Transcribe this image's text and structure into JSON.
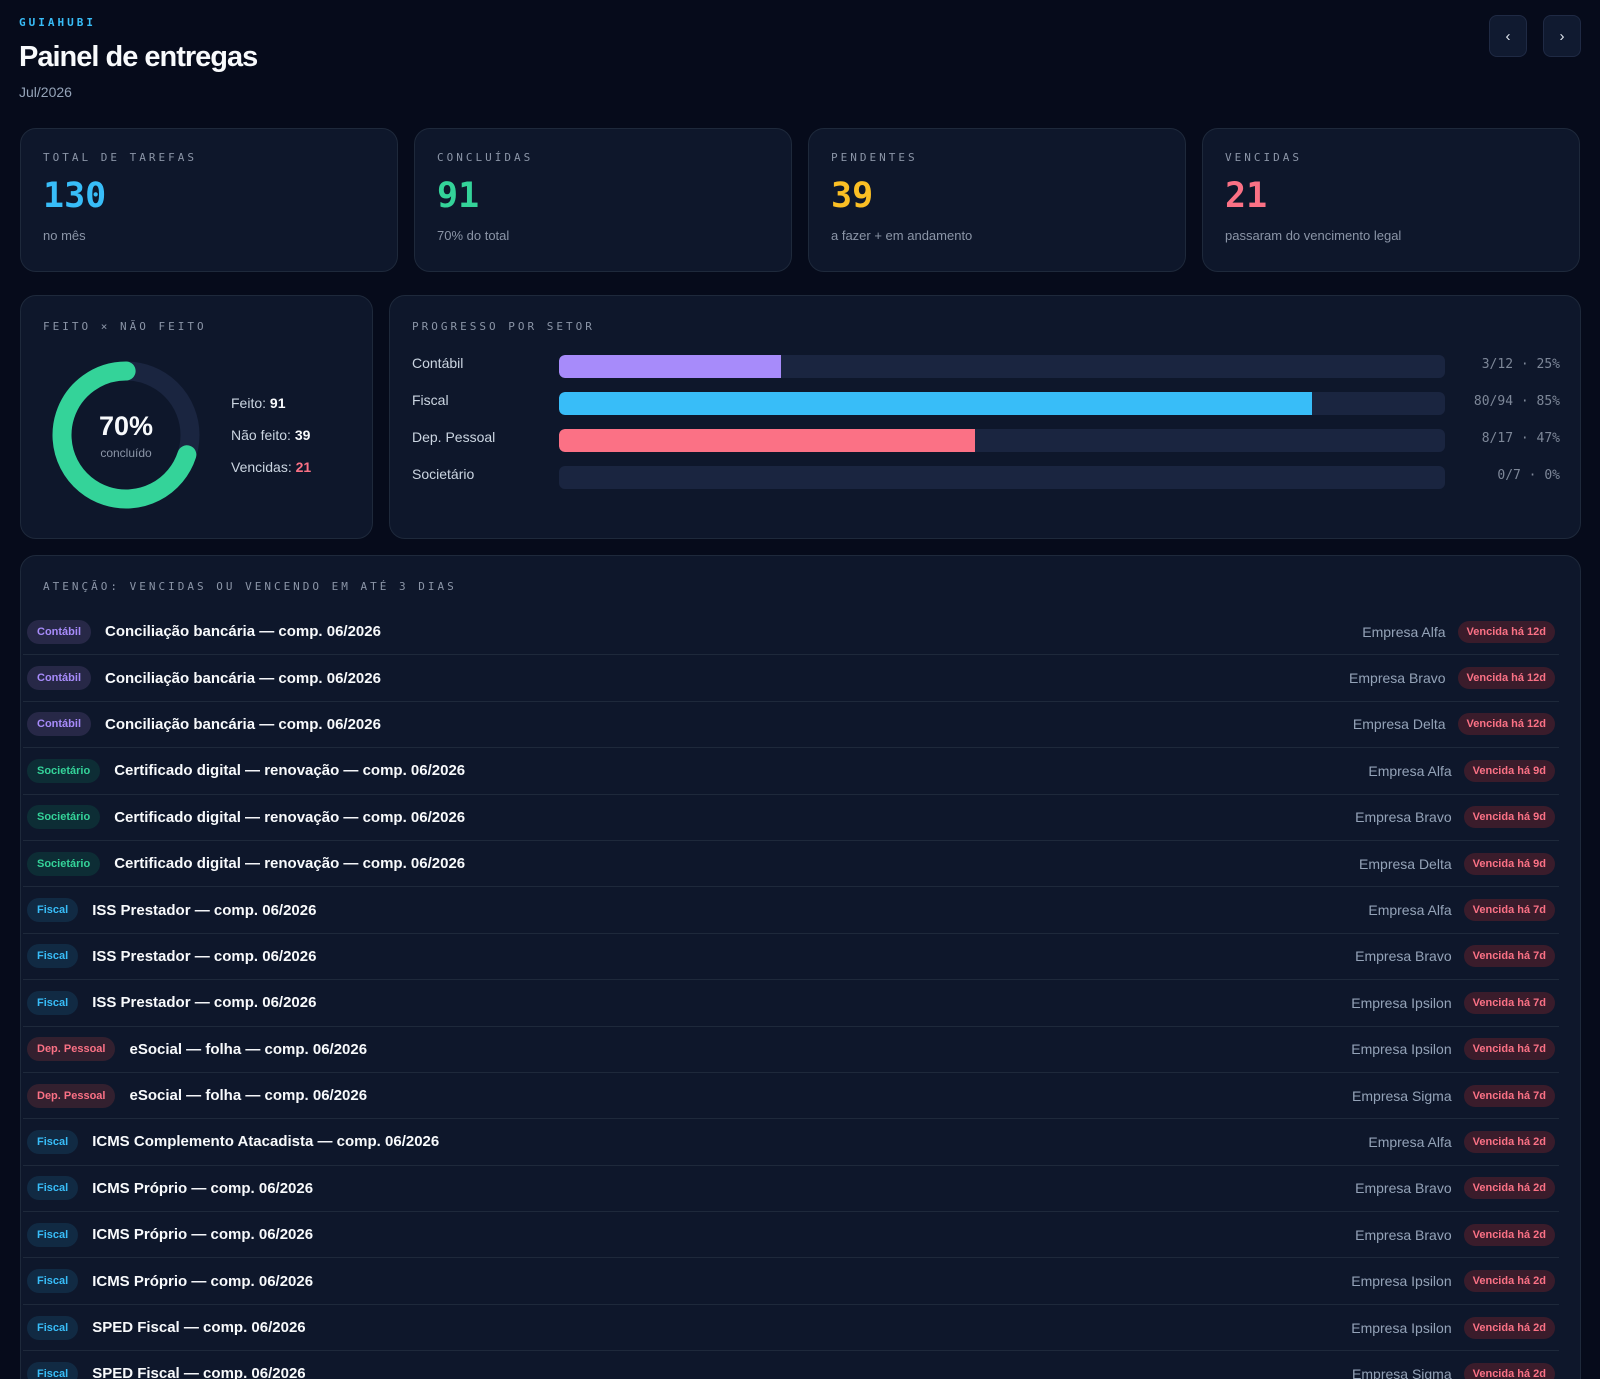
{
  "header": {
    "brand": "GUIAHUBI",
    "title": "Painel de entregas",
    "period": "Jul/2026",
    "prev_label": "‹",
    "next_label": "›"
  },
  "kpis": [
    {
      "label": "TOTAL DE TAREFAS",
      "value": "130",
      "note": "no mês",
      "color": "#38bdf8"
    },
    {
      "label": "CONCLUÍDAS",
      "value": "91",
      "note": "70% do total",
      "color": "#34d399"
    },
    {
      "label": "PENDENTES",
      "value": "39",
      "note": "a fazer + em andamento",
      "color": "#fbbf24"
    },
    {
      "label": "VENCIDAS",
      "value": "21",
      "note": "passaram do vencimento legal",
      "color": "#fb7185"
    }
  ],
  "done_panel": {
    "label": "FEITO × NÃO FEITO",
    "percent": "70%",
    "percent_value": 0.7,
    "caption": "concluído",
    "legend": [
      {
        "label": "Feito:",
        "value": "91"
      },
      {
        "label": "Não feito:",
        "value": "39"
      },
      {
        "label": "Vencidas:",
        "value": "21"
      }
    ],
    "colors": {
      "done": "#34d399",
      "track": "#1a2540",
      "overdue": "#fb7185"
    }
  },
  "sector_panel": {
    "label": "PROGRESSO POR SETOR",
    "sectors": [
      {
        "name": "Contábil",
        "stat": "3/12 · 25%",
        "progress": 0.25,
        "color": "#a78bfa"
      },
      {
        "name": "Fiscal",
        "stat": "80/94 · 85%",
        "progress": 0.85,
        "color": "#38bdf8"
      },
      {
        "name": "Dep. Pessoal",
        "stat": "8/17 · 47%",
        "progress": 0.47,
        "color": "#fb7185"
      },
      {
        "name": "Societário",
        "stat": "0/7 · 0%",
        "progress": 0.0,
        "color": "#34d399"
      }
    ]
  },
  "alerts": {
    "label": "ATENÇÃO: VENCIDAS OU VENCENDO EM ATÉ 3 DIAS",
    "rows": [
      {
        "tag": "Contábil",
        "tag_type": "contabil",
        "title": "Conciliação bancária — comp. 06/2026",
        "company": "Empresa Alfa",
        "due": "Vencida há 12d"
      },
      {
        "tag": "Contábil",
        "tag_type": "contabil",
        "title": "Conciliação bancária — comp. 06/2026",
        "company": "Empresa Bravo",
        "due": "Vencida há 12d"
      },
      {
        "tag": "Contábil",
        "tag_type": "contabil",
        "title": "Conciliação bancária — comp. 06/2026",
        "company": "Empresa Delta",
        "due": "Vencida há 12d"
      },
      {
        "tag": "Societário",
        "tag_type": "societario",
        "title": "Certificado digital — renovação — comp. 06/2026",
        "company": "Empresa Alfa",
        "due": "Vencida há 9d"
      },
      {
        "tag": "Societário",
        "tag_type": "societario",
        "title": "Certificado digital — renovação — comp. 06/2026",
        "company": "Empresa Bravo",
        "due": "Vencida há 9d"
      },
      {
        "tag": "Societário",
        "tag_type": "societario",
        "title": "Certificado digital — renovação — comp. 06/2026",
        "company": "Empresa Delta",
        "due": "Vencida há 9d"
      },
      {
        "tag": "Fiscal",
        "tag_type": "fiscal",
        "title": "ISS Prestador — comp. 06/2026",
        "company": "Empresa Alfa",
        "due": "Vencida há 7d"
      },
      {
        "tag": "Fiscal",
        "tag_type": "fiscal",
        "title": "ISS Prestador — comp. 06/2026",
        "company": "Empresa Bravo",
        "due": "Vencida há 7d"
      },
      {
        "tag": "Fiscal",
        "tag_type": "fiscal",
        "title": "ISS Prestador — comp. 06/2026",
        "company": "Empresa Ipsilon",
        "due": "Vencida há 7d"
      },
      {
        "tag": "Dep. Pessoal",
        "tag_type": "pessoal",
        "title": "eSocial — folha — comp. 06/2026",
        "company": "Empresa Ipsilon",
        "due": "Vencida há 7d"
      },
      {
        "tag": "Dep. Pessoal",
        "tag_type": "pessoal",
        "title": "eSocial — folha — comp. 06/2026",
        "company": "Empresa Sigma",
        "due": "Vencida há 7d"
      },
      {
        "tag": "Fiscal",
        "tag_type": "fiscal",
        "title": "ICMS Complemento Atacadista — comp. 06/2026",
        "company": "Empresa Alfa",
        "due": "Vencida há 2d"
      },
      {
        "tag": "Fiscal",
        "tag_type": "fiscal",
        "title": "ICMS Próprio — comp. 06/2026",
        "company": "Empresa Bravo",
        "due": "Vencida há 2d"
      },
      {
        "tag": "Fiscal",
        "tag_type": "fiscal",
        "title": "ICMS Próprio — comp. 06/2026",
        "company": "Empresa Bravo",
        "due": "Vencida há 2d"
      },
      {
        "tag": "Fiscal",
        "tag_type": "fiscal",
        "title": "ICMS Próprio — comp. 06/2026",
        "company": "Empresa Ipsilon",
        "due": "Vencida há 2d"
      },
      {
        "tag": "Fiscal",
        "tag_type": "fiscal",
        "title": "SPED Fiscal — comp. 06/2026",
        "company": "Empresa Ipsilon",
        "due": "Vencida há 2d"
      },
      {
        "tag": "Fiscal",
        "tag_type": "fiscal",
        "title": "SPED Fiscal — comp. 06/2026",
        "company": "Empresa Sigma",
        "due": "Vencida há 2d"
      }
    ]
  }
}
